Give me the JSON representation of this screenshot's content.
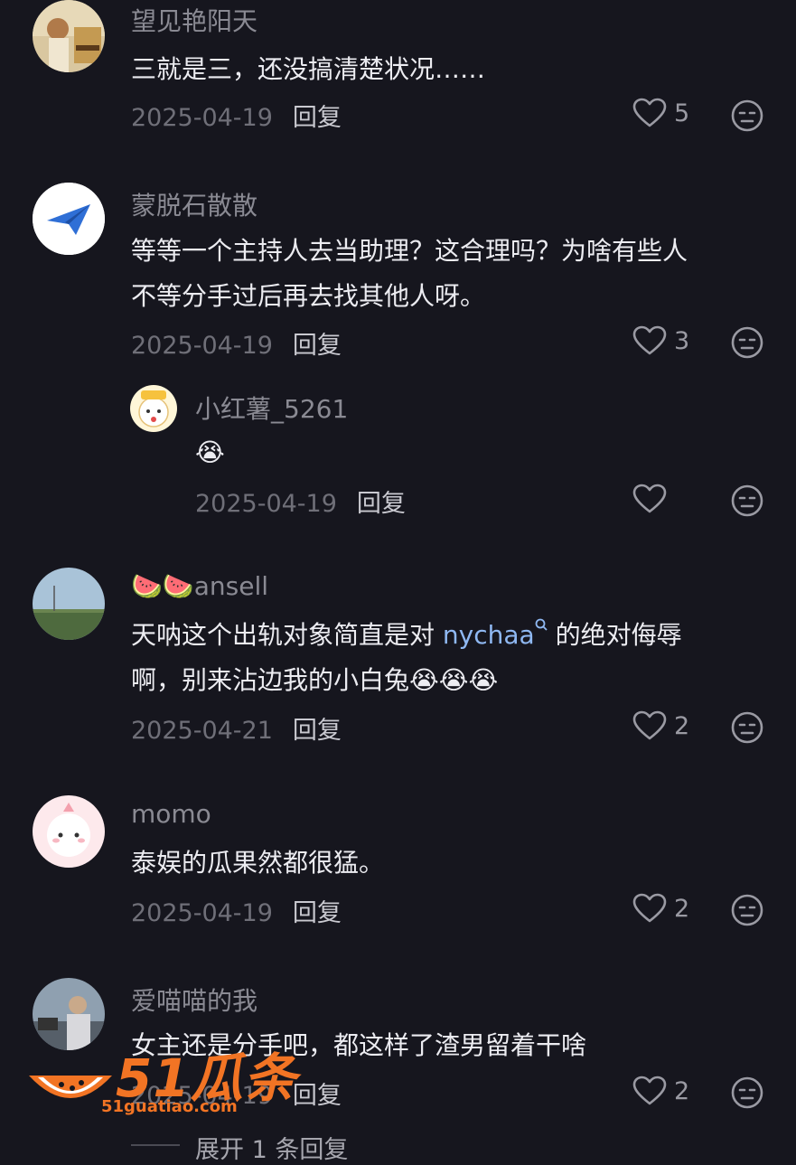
{
  "comments": [
    {
      "user": "望见艳阳天",
      "lines": [
        "三就是三，还没搞清楚状况……"
      ],
      "date": "2025-04-19",
      "reply": "回复",
      "likes": "5"
    },
    {
      "user": "蒙脱石散散",
      "lines": [
        "等等一个主持人去当助理？这合理吗？为啥有些人",
        "不等分手过后再去找其他人呀。"
      ],
      "date": "2025-04-19",
      "reply": "回复",
      "likes": "3"
    },
    {
      "user": "小红薯_5261",
      "lines": [
        "😭"
      ],
      "date": "2025-04-19",
      "reply": "回复",
      "likes": ""
    },
    {
      "user": "ansell",
      "user_prefix": "🍉🍉",
      "lines": [
        "天呐这个出轨对象简直是对 ",
        "啊，别来沾边我的小白兔"
      ],
      "mention": "nychaa",
      "line1_suffix": " 的绝对侮辱",
      "emoji_tail": "😭😭😭",
      "date": "2025-04-21",
      "reply": "回复",
      "likes": "2"
    },
    {
      "user": "momo",
      "lines": [
        "泰娱的瓜果然都很猛。"
      ],
      "date": "2025-04-19",
      "reply": "回复",
      "likes": "2"
    },
    {
      "user": "爱喵喵的我",
      "lines": [
        "女主还是分手吧，都这样了渣男留着干啥"
      ],
      "date": "2025-04-19",
      "reply": "回复",
      "likes": "2"
    }
  ],
  "expand_replies": "展开 1 条回复",
  "watermark": {
    "brand": "51瓜条",
    "url": "51guatiao.com"
  },
  "colors": {
    "background": "#16161e",
    "link": "#8fb8f2",
    "watermark": "#f27424"
  }
}
